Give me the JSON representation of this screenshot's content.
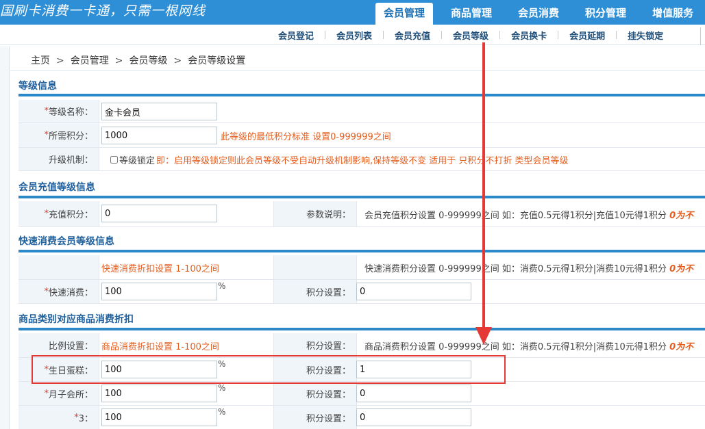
{
  "header": {
    "slogan": "国刷卡消费一卡通，只需一根网线",
    "tabs": [
      {
        "label": "会员管理",
        "active": true
      },
      {
        "label": "商品管理",
        "active": false
      },
      {
        "label": "会员消费",
        "active": false
      },
      {
        "label": "积分管理",
        "active": false
      },
      {
        "label": "增值服务",
        "active": false
      }
    ]
  },
  "subnav": [
    "会员登记",
    "会员列表",
    "会员充值",
    "会员等级",
    "会员换卡",
    "会员延期",
    "挂失锁定"
  ],
  "breadcrumb": [
    "主页",
    "会员管理",
    "会员等级",
    "会员等级设置"
  ],
  "breadcrumb_sep": ">",
  "required_mark": "*",
  "colors": {
    "primary": "#2e8fd6",
    "section_bar": "#2b88c9",
    "hint": "#e35d1e",
    "annotation": "#e53935"
  },
  "section1": {
    "title": "等级信息",
    "name_label": "等级名称：",
    "name_value": "金卡会员",
    "points_label": "所需积分：",
    "points_value": "1000",
    "points_hint": "此等级的最低积分标准 设置0-999999之间",
    "upgrade_label": "升级机制：",
    "lock_label": "等级锁定",
    "lock_checked": false,
    "lock_hint": "即：启用等级锁定则此会员等级不受自动升级机制影响,保持等级不变 适用于 只积分不打折 类型会员等级"
  },
  "section2": {
    "title": "会员充值等级信息",
    "recharge_label": "充值积分：",
    "recharge_value": "0",
    "param_label": "参数说明：",
    "param_desc": "会员充值积分设置 0-999999之间 如：充值0.5元得1积分|充值10元得1积分",
    "param_em": "0为不"
  },
  "section3": {
    "title": "快速消费会员等级信息",
    "discount_hint": "快速消费折扣设置 1-100之间",
    "points_desc": "快速消费积分设置 0-999999之间 如：消费0.5元得1积分|消费10元得1积分",
    "points_em": "0为不",
    "quick_label": "快速消费：",
    "quick_value": "100",
    "percent": "%",
    "points_label": "积分设置：",
    "points_value": "0"
  },
  "section4": {
    "title": "商品类别对应商品消费折扣",
    "ratio_label": "比例设置：",
    "ratio_hint": "商品消费折扣设置 1-100之间",
    "points_label": "积分设置：",
    "points_desc": "商品消费积分设置 0-999999之间 如：消费0.5元得1积分|消费10元得1积分",
    "points_em": "0为不",
    "rows": [
      {
        "label": "生日蛋糕：",
        "discount": "100",
        "points": "1"
      },
      {
        "label": "月子会所：",
        "discount": "100",
        "points": "0"
      },
      {
        "label": "3：",
        "discount": "100",
        "points": "0"
      }
    ]
  }
}
